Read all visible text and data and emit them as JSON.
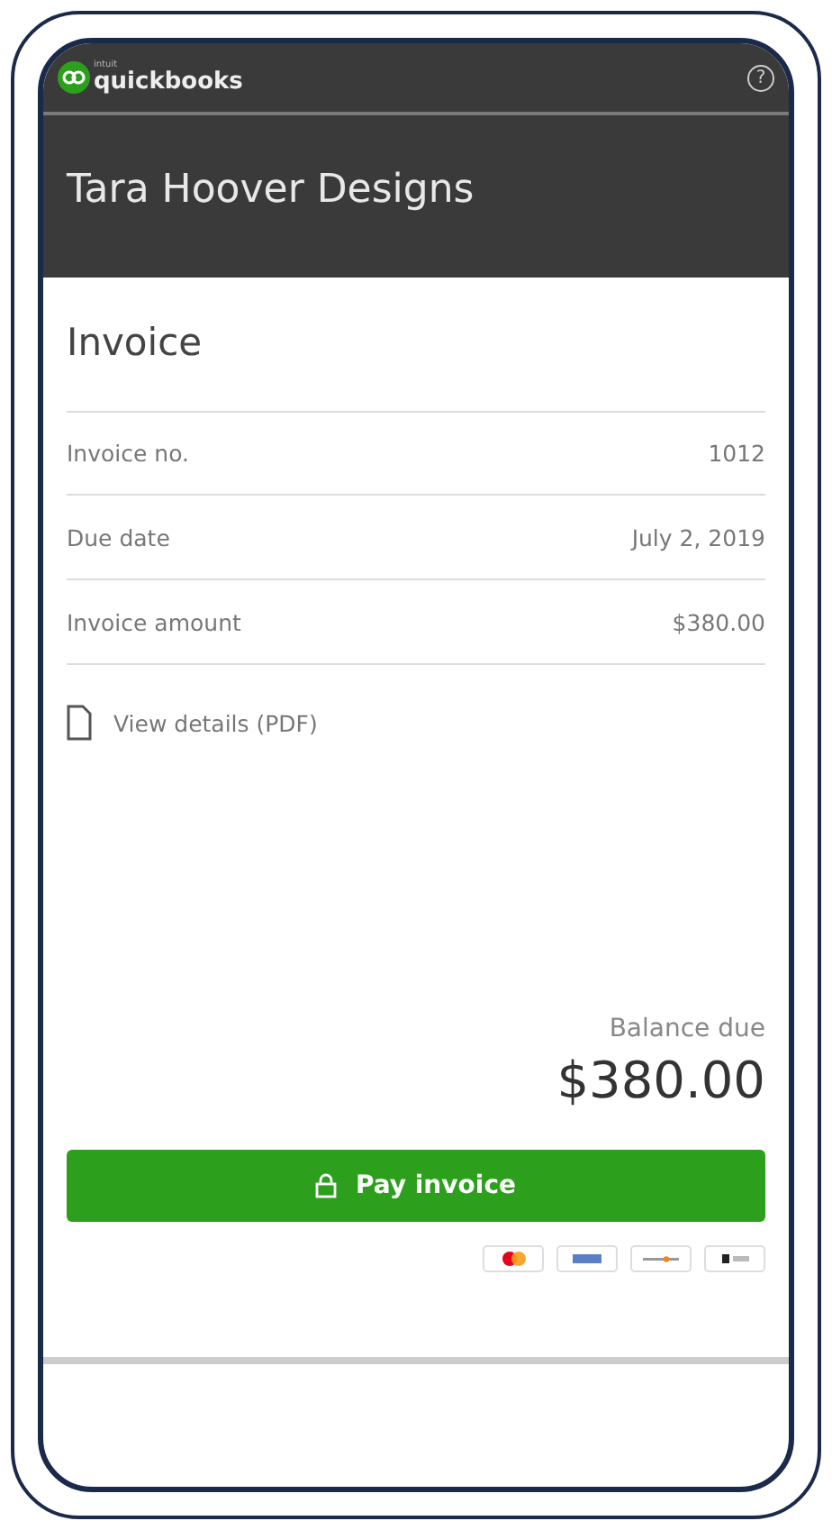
{
  "app_bar": {
    "brand_small": "intuit",
    "brand": "quickbooks",
    "help_icon": "?"
  },
  "company": "Tara Hoover Designs",
  "invoice": {
    "heading": "Invoice",
    "fields": [
      {
        "label": "Invoice no.",
        "value": "1012"
      },
      {
        "label": "Due date",
        "value": "July 2, 2019"
      },
      {
        "label": "Invoice amount",
        "value": "$380.00"
      }
    ],
    "details_link": "View details (PDF)"
  },
  "balance": {
    "label": "Balance due",
    "amount": "$380.00"
  },
  "pay_button": "Pay invoice",
  "payment_methods": [
    {
      "kind": "mastercard"
    },
    {
      "kind": "visa"
    },
    {
      "kind": "discover"
    },
    {
      "kind": "applepay"
    }
  ]
}
